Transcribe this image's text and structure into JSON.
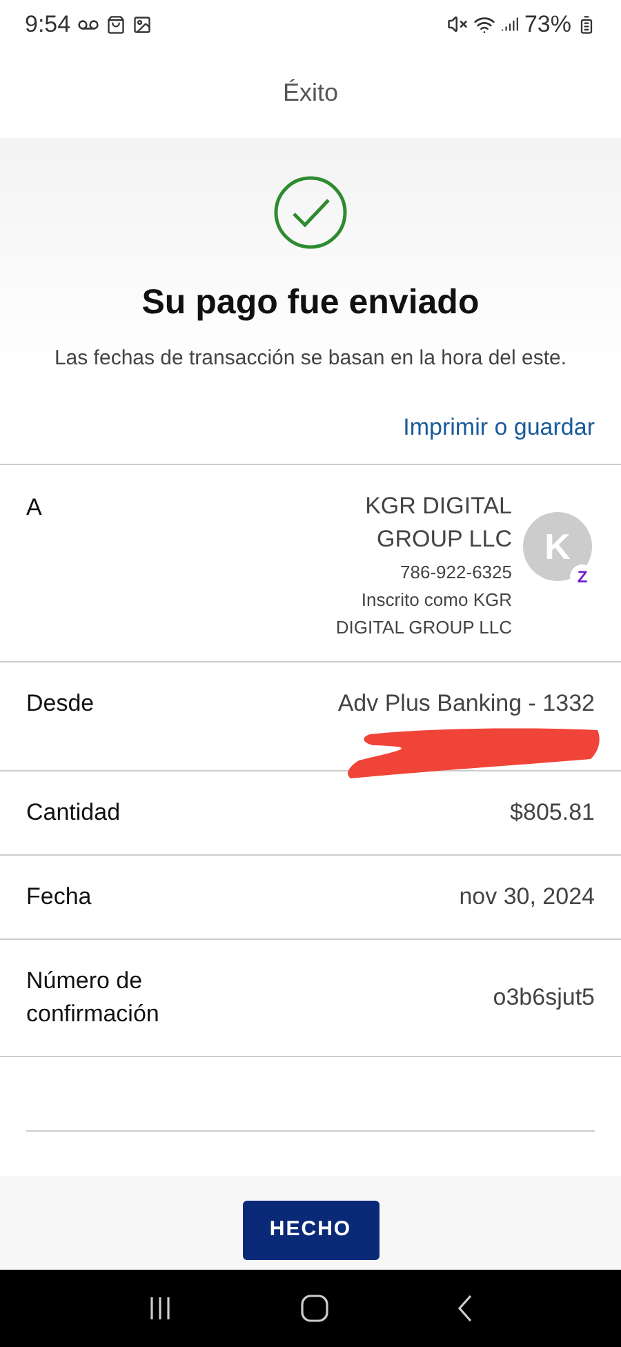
{
  "status_bar": {
    "time": "9:54",
    "battery": "73%"
  },
  "header": {
    "title": "Éxito"
  },
  "result": {
    "title": "Su pago fue enviado",
    "note": "Las fechas de transacción se basan en la hora del este.",
    "link": "Imprimir o guardar"
  },
  "recipient": {
    "label": "A",
    "name": "KGR DIGITAL GROUP LLC",
    "phone": "786-922-6325",
    "enrolled": "Inscrito como KGR DIGITAL GROUP LLC",
    "avatar": "K",
    "badge": "Z"
  },
  "details": [
    {
      "label": "Desde",
      "value": "Adv Plus Banking - 1332",
      "redacted": true
    },
    {
      "label": "Cantidad",
      "value": "$805.81",
      "redacted": false
    },
    {
      "label": "Fecha",
      "value": "nov 30, 2024",
      "redacted": false
    },
    {
      "label": "Número de confirmación",
      "value": "o3b6sjut5",
      "redacted": false
    }
  ],
  "footer": {
    "button": "HECHO"
  }
}
